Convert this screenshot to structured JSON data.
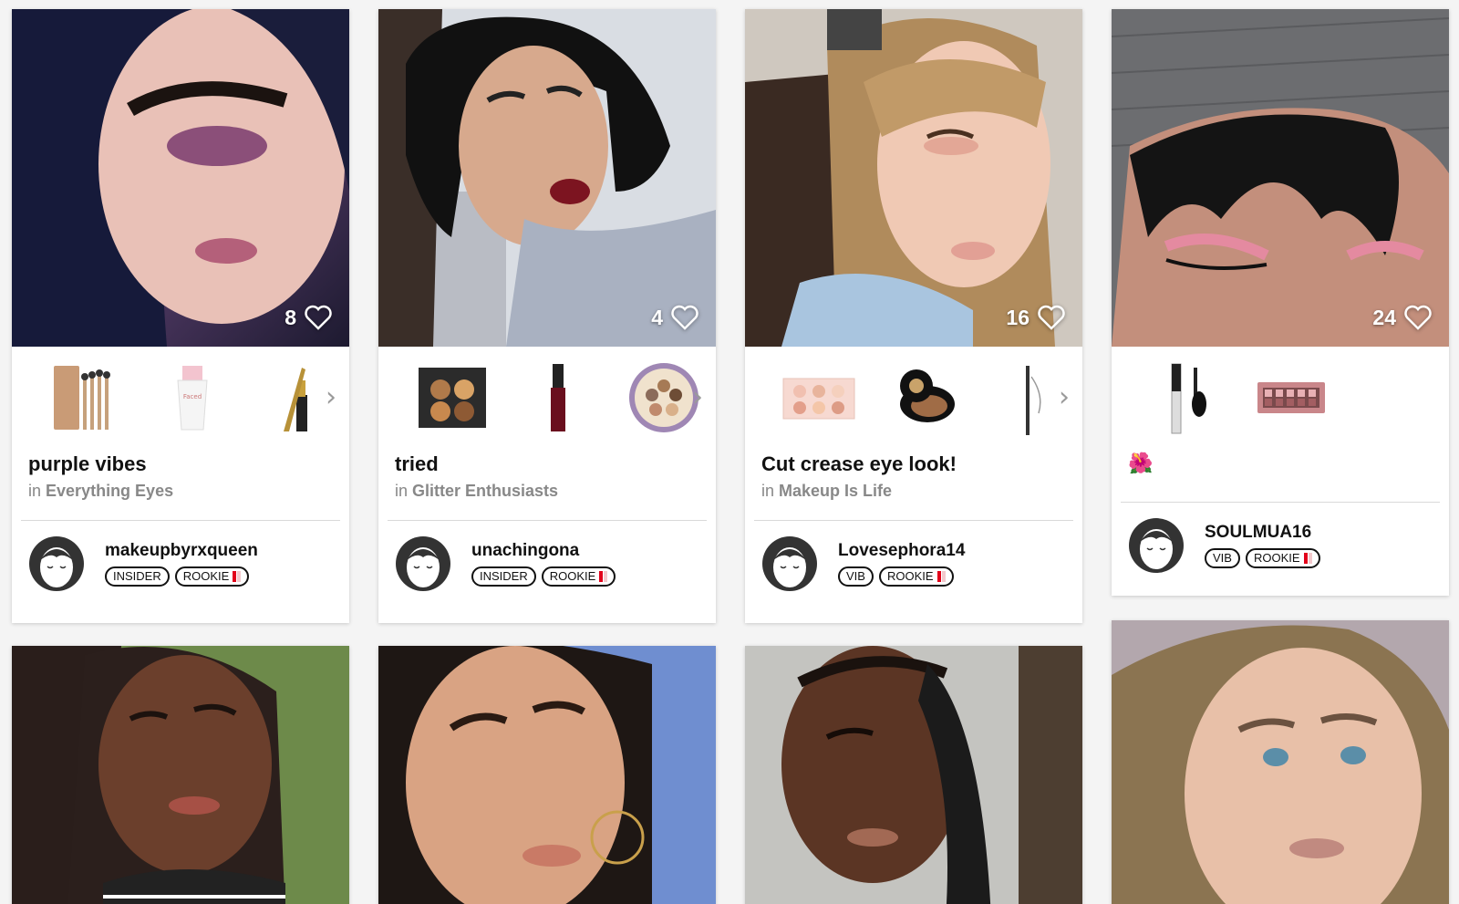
{
  "cards": [
    {
      "likes": "8",
      "title": "purple vibes",
      "group_prefix": "in",
      "group": "Everything Eyes",
      "username": "makeupbyrxqueen",
      "badges": [
        "INSIDER",
        "ROOKIE"
      ],
      "products": [
        "brush-set-icon",
        "primer-tube-icon",
        "eyeliner-pen-icon"
      ]
    },
    {
      "likes": "4",
      "title": "tried",
      "group_prefix": "in",
      "group": "Glitter Enthusiasts",
      "username": "unachingona",
      "badges": [
        "INSIDER",
        "ROOKIE"
      ],
      "products": [
        "contour-palette-icon",
        "liquid-lipstick-icon",
        "eyeshadow-tin-icon"
      ]
    },
    {
      "likes": "16",
      "title": "Cut crease eye look!",
      "group_prefix": "in",
      "group": "Makeup Is Life",
      "username": "Lovesephora14",
      "badges": [
        "VIB",
        "ROOKIE"
      ],
      "products": [
        "highlight-palette-icon",
        "brow-pomade-icon",
        "brow-pencil-icon"
      ]
    },
    {
      "likes": "24",
      "title": "🌺",
      "username": "SOULMUA16",
      "badges": [
        "VIB",
        "ROOKIE"
      ],
      "products": [
        "mascara-icon",
        "eyeshadow-palette-icon"
      ]
    }
  ],
  "colors": {
    "heart": "#ffffff",
    "divider": "#d9d9d9",
    "rookie_bar": "#e2001a"
  }
}
